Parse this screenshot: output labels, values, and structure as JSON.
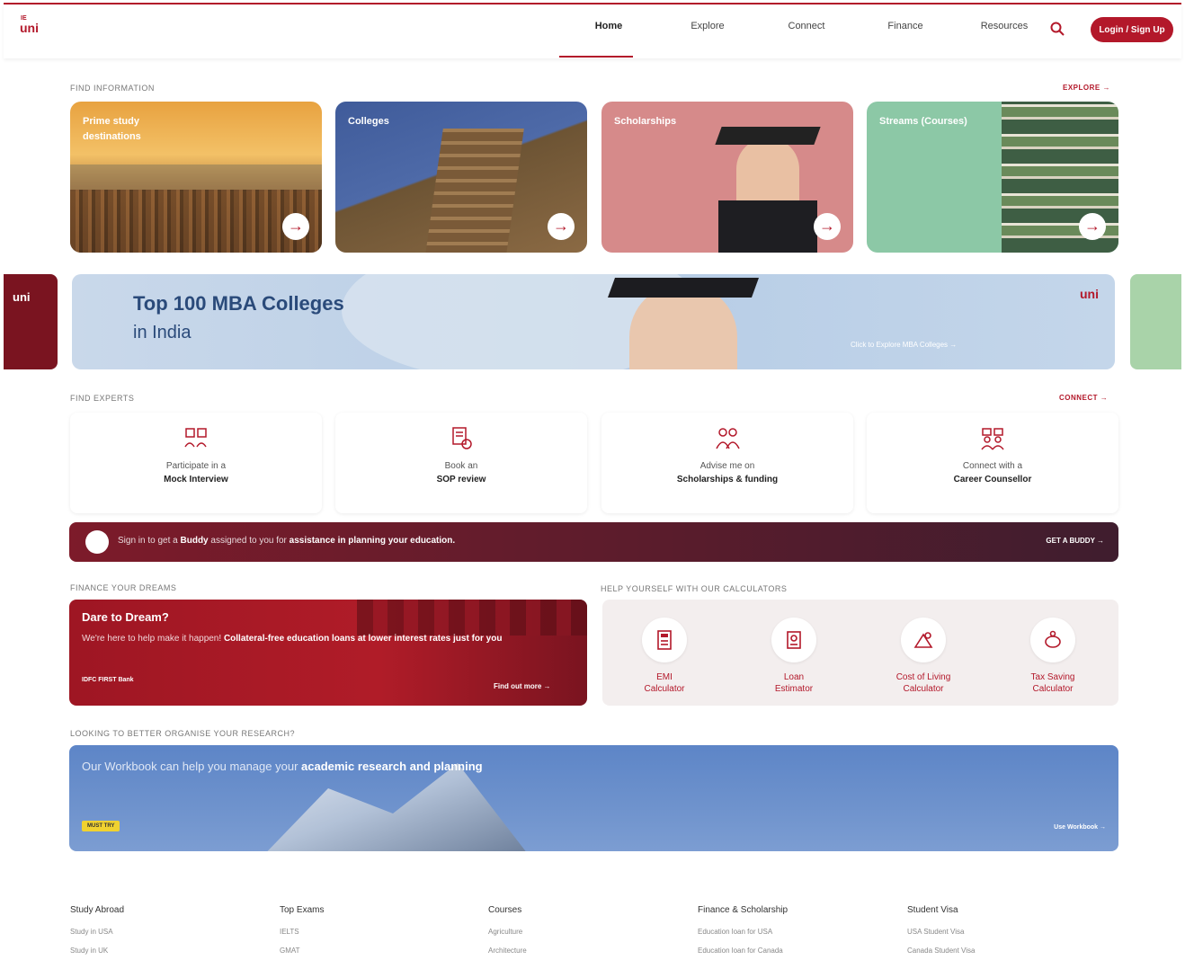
{
  "header": {
    "logo": "uni",
    "logo_prefix": "IE",
    "nav": [
      "Home",
      "Explore",
      "Connect",
      "Finance",
      "Resources"
    ],
    "login_label": "Login / Sign Up"
  },
  "find_info": {
    "label": "FIND INFORMATION",
    "link": "EXPLORE →",
    "cards": [
      {
        "title": "Prime study destinations"
      },
      {
        "title": "Colleges"
      },
      {
        "title": "Scholarships"
      },
      {
        "title": "Streams (Courses)"
      }
    ]
  },
  "banner": {
    "title": "Top 100 MBA Colleges",
    "subtitle": "in India",
    "link": "Click to Explore MBA Colleges →",
    "logo": "uni",
    "side_logo": "uni"
  },
  "experts": {
    "label": "FIND EXPERTS",
    "link": "CONNECT →",
    "items": [
      {
        "line1": "Participate in a",
        "line2": "Mock Interview"
      },
      {
        "line1": "Book an",
        "line2": "SOP review"
      },
      {
        "line1": "Advise me on",
        "line2": "Scholarships & funding"
      },
      {
        "line1": "Connect with a",
        "line2": "Career Counsellor"
      }
    ]
  },
  "buddy": {
    "text_a": "Sign in to get a ",
    "text_b": "Buddy",
    "text_c": " assigned to you for ",
    "text_d": "assistance in planning your education.",
    "link": "GET A BUDDY →"
  },
  "finance": {
    "label": "FINANCE YOUR DREAMS",
    "title": "Dare to Dream?",
    "text_a": "We're here to help make it happen! ",
    "text_b": "Collateral-free education loans at lower interest rates just for you",
    "bank": "IDFC FIRST Bank",
    "link": "Find out more →"
  },
  "calculators": {
    "label": "HELP YOURSELF WITH OUR CALCULATORS",
    "items": [
      {
        "line1": "EMI",
        "line2": "Calculator"
      },
      {
        "line1": "Loan",
        "line2": "Estimator"
      },
      {
        "line1": "Cost of Living",
        "line2": "Calculator"
      },
      {
        "line1": "Tax Saving",
        "line2": "Calculator"
      }
    ]
  },
  "workbook": {
    "label": "LOOKING TO BETTER ORGANISE YOUR RESEARCH?",
    "text_a": "Our Workbook can help you manage your ",
    "text_b": "academic research and planning",
    "badge": "MUST TRY",
    "link": "Use Workbook →"
  },
  "footer": [
    {
      "head": "Study Abroad",
      "items": [
        "Study in USA",
        "Study in UK"
      ]
    },
    {
      "head": "Top Exams",
      "items": [
        "IELTS",
        "GMAT"
      ]
    },
    {
      "head": "Courses",
      "items": [
        "Agriculture",
        "Architecture"
      ]
    },
    {
      "head": "Finance & Scholarship",
      "items": [
        "Education loan for USA",
        "Education loan for Canada"
      ]
    },
    {
      "head": "Student Visa",
      "items": [
        "USA Student Visa",
        "Canada Student Visa"
      ]
    }
  ],
  "colors": {
    "brand": "#b3182a",
    "banner_text": "#2a4a7a",
    "workbook": "#6f93cd"
  }
}
